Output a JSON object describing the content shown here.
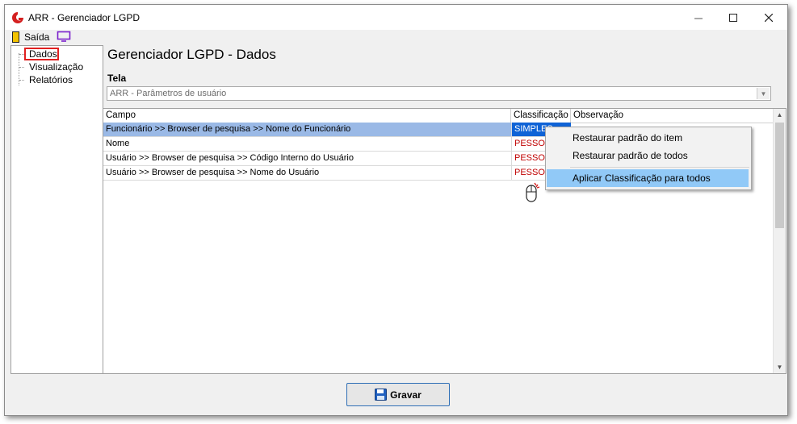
{
  "window": {
    "title": "ARR - Gerenciador LGPD",
    "app_icon": "arr-logo-icon",
    "controls": [
      "minimize-icon",
      "maximize-icon",
      "close-icon"
    ]
  },
  "menubar": {
    "exit_label": "Saída",
    "exit_icon": "exit-door-icon",
    "monitor_icon": "monitor-icon"
  },
  "sidebar": {
    "items": [
      {
        "label": "Dados",
        "selected": true
      },
      {
        "label": "Visualização"
      },
      {
        "label": "Relatórios"
      }
    ]
  },
  "main": {
    "title": "Gerenciador LGPD - Dados",
    "tela_label": "Tela",
    "tela_value": "ARR - Parâmetros de usuário",
    "grid": {
      "columns": [
        "Campo",
        "Classificação",
        "Observação"
      ],
      "rows": [
        {
          "campo": "Funcionário >> Browser de pesquisa >> Nome do Funcionário",
          "classificacao": "SIMPLES",
          "selected": true
        },
        {
          "campo": "Nome",
          "classificacao": "PESSOAL"
        },
        {
          "campo": "Usuário >> Browser de pesquisa >> Código Interno do Usuário",
          "classificacao": "PESSOAL"
        },
        {
          "campo": "Usuário >> Browser de pesquisa >> Nome do Usuário",
          "classificacao": "PESSOAL"
        }
      ]
    }
  },
  "context_menu": {
    "items": [
      {
        "label": "Restaurar padrão do item"
      },
      {
        "label": "Restaurar padrão de todos"
      },
      {
        "label": "Aplicar Classificação para todos",
        "highlighted": true
      }
    ]
  },
  "footer": {
    "save_label": "Gravar",
    "save_icon": "floppy-disk-icon"
  },
  "colors": {
    "selection": "#0f63d6",
    "row_highlight": "#9ab9e6",
    "classification_text": "#c00000",
    "menu_highlight": "#91c9f7",
    "tree_marker": "#e02020"
  }
}
